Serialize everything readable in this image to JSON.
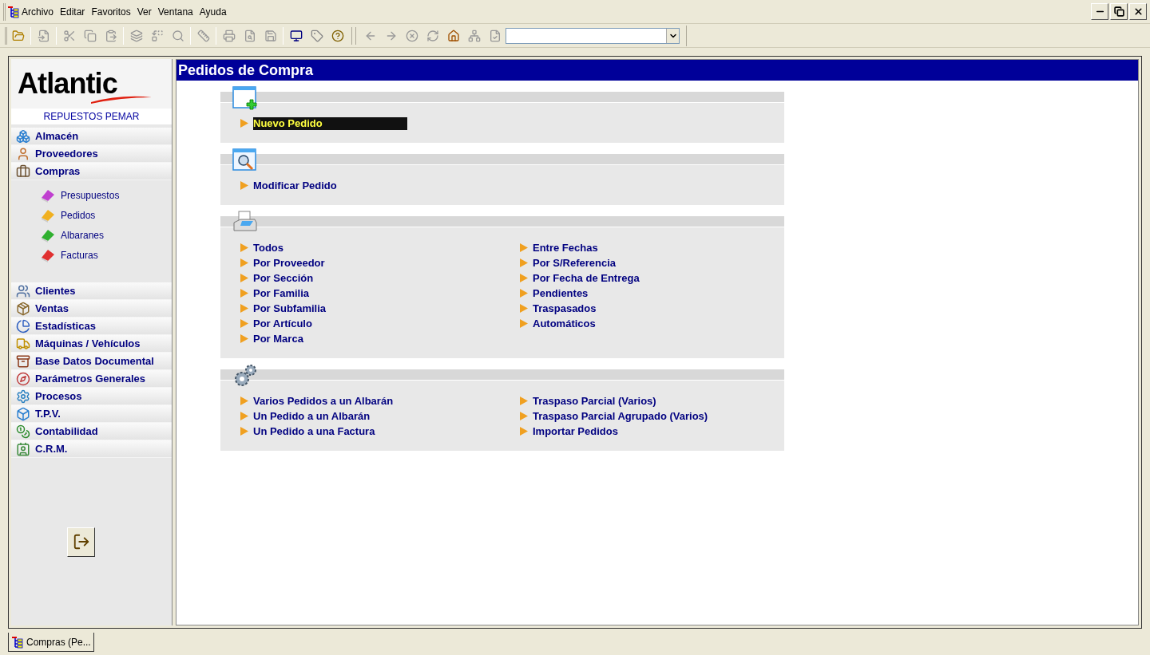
{
  "menu": [
    {
      "label": "Archivo"
    },
    {
      "label": "Editar"
    },
    {
      "label": "Favoritos"
    },
    {
      "label": "Ver"
    },
    {
      "label": "Ventana"
    },
    {
      "label": "Ayuda"
    }
  ],
  "sidebar": {
    "logo": "Atlantic",
    "company": "REPUESTOS PEMAR",
    "modules": [
      {
        "label": "Almacén"
      },
      {
        "label": "Proveedores"
      },
      {
        "label": "Compras",
        "children": [
          {
            "label": "Presupuestos",
            "color": "#c040d0"
          },
          {
            "label": "Pedidos",
            "color": "#f0b020"
          },
          {
            "label": "Albaranes",
            "color": "#30b030"
          },
          {
            "label": "Facturas",
            "color": "#e03030"
          }
        ]
      },
      {
        "label": "Clientes"
      },
      {
        "label": "Ventas"
      },
      {
        "label": "Estadísticas"
      },
      {
        "label": "Máquinas / Vehículos"
      },
      {
        "label": "Base Datos Documental"
      },
      {
        "label": "Parámetros Generales"
      },
      {
        "label": "Procesos"
      },
      {
        "label": "T.P.V."
      },
      {
        "label": "Contabilidad"
      },
      {
        "label": "C.R.M."
      }
    ]
  },
  "main": {
    "title": "Pedidos de Compra",
    "sections": [
      {
        "kind": "new",
        "columns": [
          [
            {
              "label": "Nuevo Pedido",
              "selected": true
            }
          ]
        ]
      },
      {
        "kind": "search",
        "columns": [
          [
            {
              "label": "Modificar Pedido",
              "selected": false
            }
          ]
        ]
      },
      {
        "kind": "print",
        "columns": [
          [
            {
              "label": "Todos",
              "selected": false
            },
            {
              "label": "Por Proveedor",
              "selected": false
            },
            {
              "label": "Por Sección",
              "selected": false
            },
            {
              "label": "Por Familia",
              "selected": false
            },
            {
              "label": "Por Subfamilia",
              "selected": false
            },
            {
              "label": "Por Artículo",
              "selected": false
            },
            {
              "label": "Por Marca",
              "selected": false
            }
          ],
          [
            {
              "label": "Entre Fechas",
              "selected": false
            },
            {
              "label": "Por S/Referencia",
              "selected": false
            },
            {
              "label": "Por Fecha de Entrega",
              "selected": false
            },
            {
              "label": "Pendientes",
              "selected": false
            },
            {
              "label": "Traspasados",
              "selected": false
            },
            {
              "label": "Automáticos",
              "selected": false
            }
          ]
        ]
      },
      {
        "kind": "process",
        "columns": [
          [
            {
              "label": "Varios Pedidos a un Albarán",
              "selected": false
            },
            {
              "label": "Un Pedido a un Albarán",
              "selected": false
            },
            {
              "label": "Un Pedido a una Factura",
              "selected": false
            }
          ],
          [
            {
              "label": "Traspaso Parcial (Varios)",
              "selected": false
            },
            {
              "label": "Traspaso Parcial Agrupado (Varios)",
              "selected": false
            },
            {
              "label": "Importar Pedidos",
              "selected": false
            }
          ]
        ]
      }
    ]
  },
  "taskbar": [
    {
      "label": "Compras (Pe..."
    }
  ]
}
